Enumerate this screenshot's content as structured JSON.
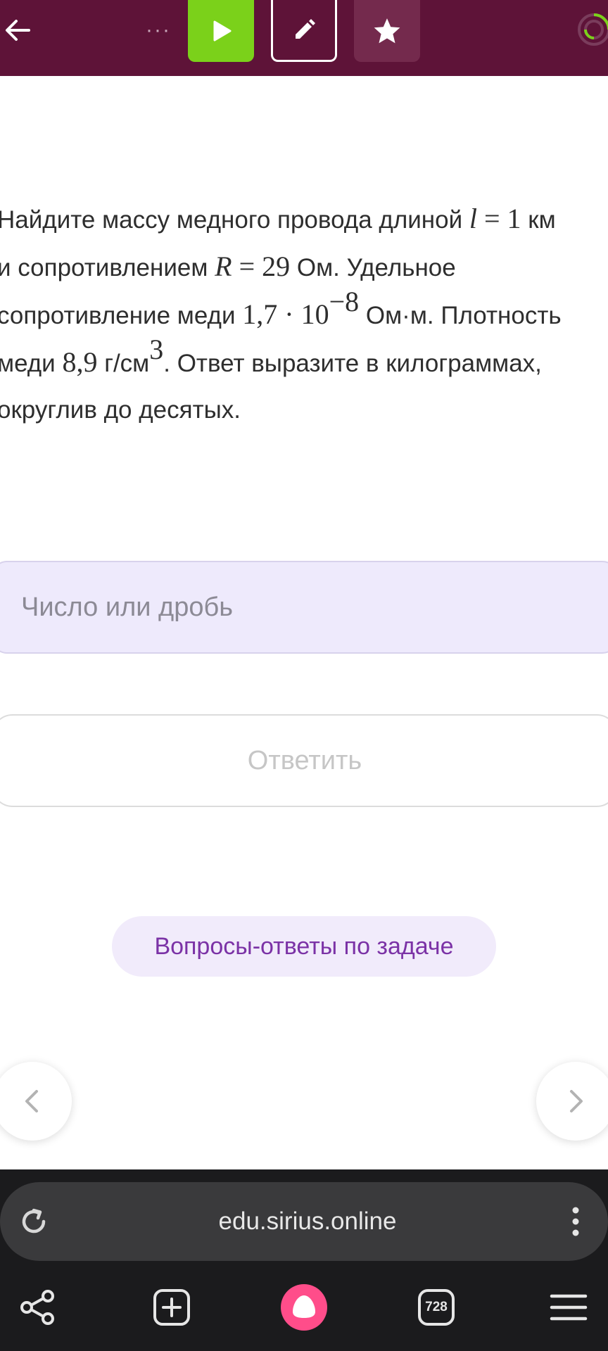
{
  "colors": {
    "topbar_bg": "#5e1338",
    "play_green": "#7bd11a",
    "input_bg": "#eeeafc",
    "qa_text": "#7b32a6",
    "alice_pink": "#ff4d8a"
  },
  "toolbar": {
    "back_icon": "arrow-left-icon",
    "more_icon": "more-dots-icon",
    "play_icon": "play-icon",
    "edit_icon": "pencil-icon",
    "favorite_icon": "star-icon",
    "progress_icon": "progress-ring-icon"
  },
  "problem": {
    "line1_text": "Найдите массу медного провода длиной ",
    "l_var": "l",
    "l_value": " = 1",
    "line1_unit": " км",
    "line2_text": "и сопротивлением ",
    "r_var": "R",
    "r_value": " = 29",
    "line2_rest": " Ом. Удельное",
    "line3_text": "сопротивление меди ",
    "resistivity_base": "1,7 · 10",
    "resistivity_exp": "−8",
    "line3_rest": " Ом·м. Плотность",
    "line4_text": "меди ",
    "density_value": "8,9",
    "density_unit": " г/см",
    "density_exp": "3",
    "line4_rest": ". Ответ выразите в килограммах,",
    "line5_text": "округлив до десятых."
  },
  "answer": {
    "placeholder": "Число или дробь",
    "value": ""
  },
  "submit_label": "Ответить",
  "qa_label": "Вопросы-ответы по задаче",
  "browser": {
    "url": "edu.sirius.online",
    "tabs_count": "728",
    "icons": {
      "reload": "reload-icon",
      "menu": "kebab-menu-icon",
      "share": "share-icon",
      "new_tab": "new-tab-icon",
      "alice": "alice-assistant-icon",
      "hamburger": "hamburger-menu-icon"
    }
  }
}
